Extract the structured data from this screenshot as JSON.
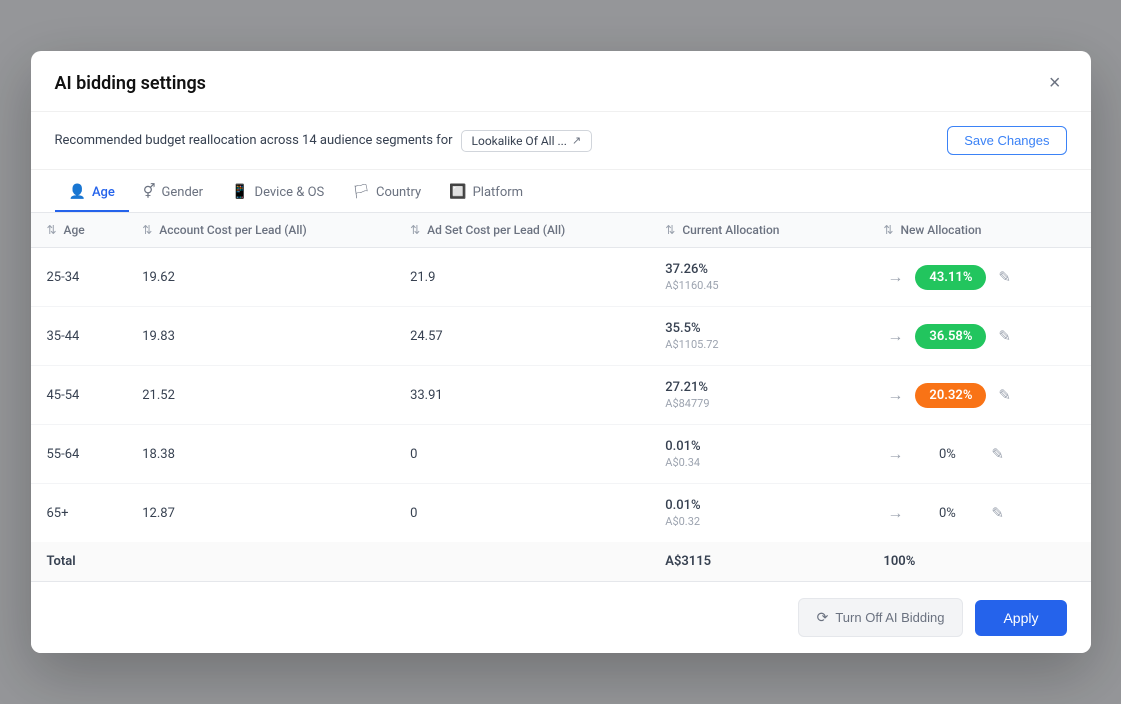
{
  "modal": {
    "title": "AI bidding settings",
    "close_label": "×",
    "subheader": {
      "description": "Recommended budget reallocation across 14 audience segments for",
      "campaign_name": "Lookalike Of All ...",
      "external_icon": "⬡",
      "save_changes_label": "Save Changes"
    },
    "tabs": [
      {
        "id": "age",
        "label": "Age",
        "icon": "👤",
        "active": true
      },
      {
        "id": "gender",
        "label": "Gender",
        "icon": "⚥",
        "active": false
      },
      {
        "id": "device-os",
        "label": "Device & OS",
        "icon": "📱",
        "active": false
      },
      {
        "id": "country",
        "label": "Country",
        "icon": "🏳",
        "active": false
      },
      {
        "id": "platform",
        "label": "Platform",
        "icon": "🔲",
        "active": false
      }
    ],
    "table": {
      "columns": [
        {
          "id": "age",
          "label": "Age",
          "sort": true
        },
        {
          "id": "account_cost",
          "label": "Account Cost per Lead (All)",
          "sort": true
        },
        {
          "id": "adset_cost",
          "label": "Ad Set Cost per Lead (All)",
          "sort": true
        },
        {
          "id": "current_allocation",
          "label": "Current Allocation",
          "sort": true
        },
        {
          "id": "new_allocation",
          "label": "New Allocation",
          "sort": true
        }
      ],
      "rows": [
        {
          "age": "25-34",
          "account_cost": "19.62",
          "adset_cost": "21.9",
          "current_pct": "37.26%",
          "current_amt": "A$1160.45",
          "arrow": "→",
          "new_alloc": "43.11%",
          "badge_type": "green"
        },
        {
          "age": "35-44",
          "account_cost": "19.83",
          "adset_cost": "24.57",
          "current_pct": "35.5%",
          "current_amt": "A$1105.72",
          "arrow": "→",
          "new_alloc": "36.58%",
          "badge_type": "green"
        },
        {
          "age": "45-54",
          "account_cost": "21.52",
          "adset_cost": "33.91",
          "current_pct": "27.21%",
          "current_amt": "A$84779",
          "arrow": "→",
          "new_alloc": "20.32%",
          "badge_type": "orange"
        },
        {
          "age": "55-64",
          "account_cost": "18.38",
          "adset_cost": "0",
          "current_pct": "0.01%",
          "current_amt": "A$0.34",
          "arrow": "→",
          "new_alloc": "0%",
          "badge_type": "neutral"
        },
        {
          "age": "65+",
          "account_cost": "12.87",
          "adset_cost": "0",
          "current_pct": "0.01%",
          "current_amt": "A$0.32",
          "arrow": "→",
          "new_alloc": "0%",
          "badge_type": "neutral"
        }
      ],
      "total_row": {
        "label": "Total",
        "current_total": "A$3115",
        "new_total": "100%"
      }
    },
    "footer": {
      "turn_off_label": "Turn Off AI Bidding",
      "apply_label": "Apply"
    }
  }
}
